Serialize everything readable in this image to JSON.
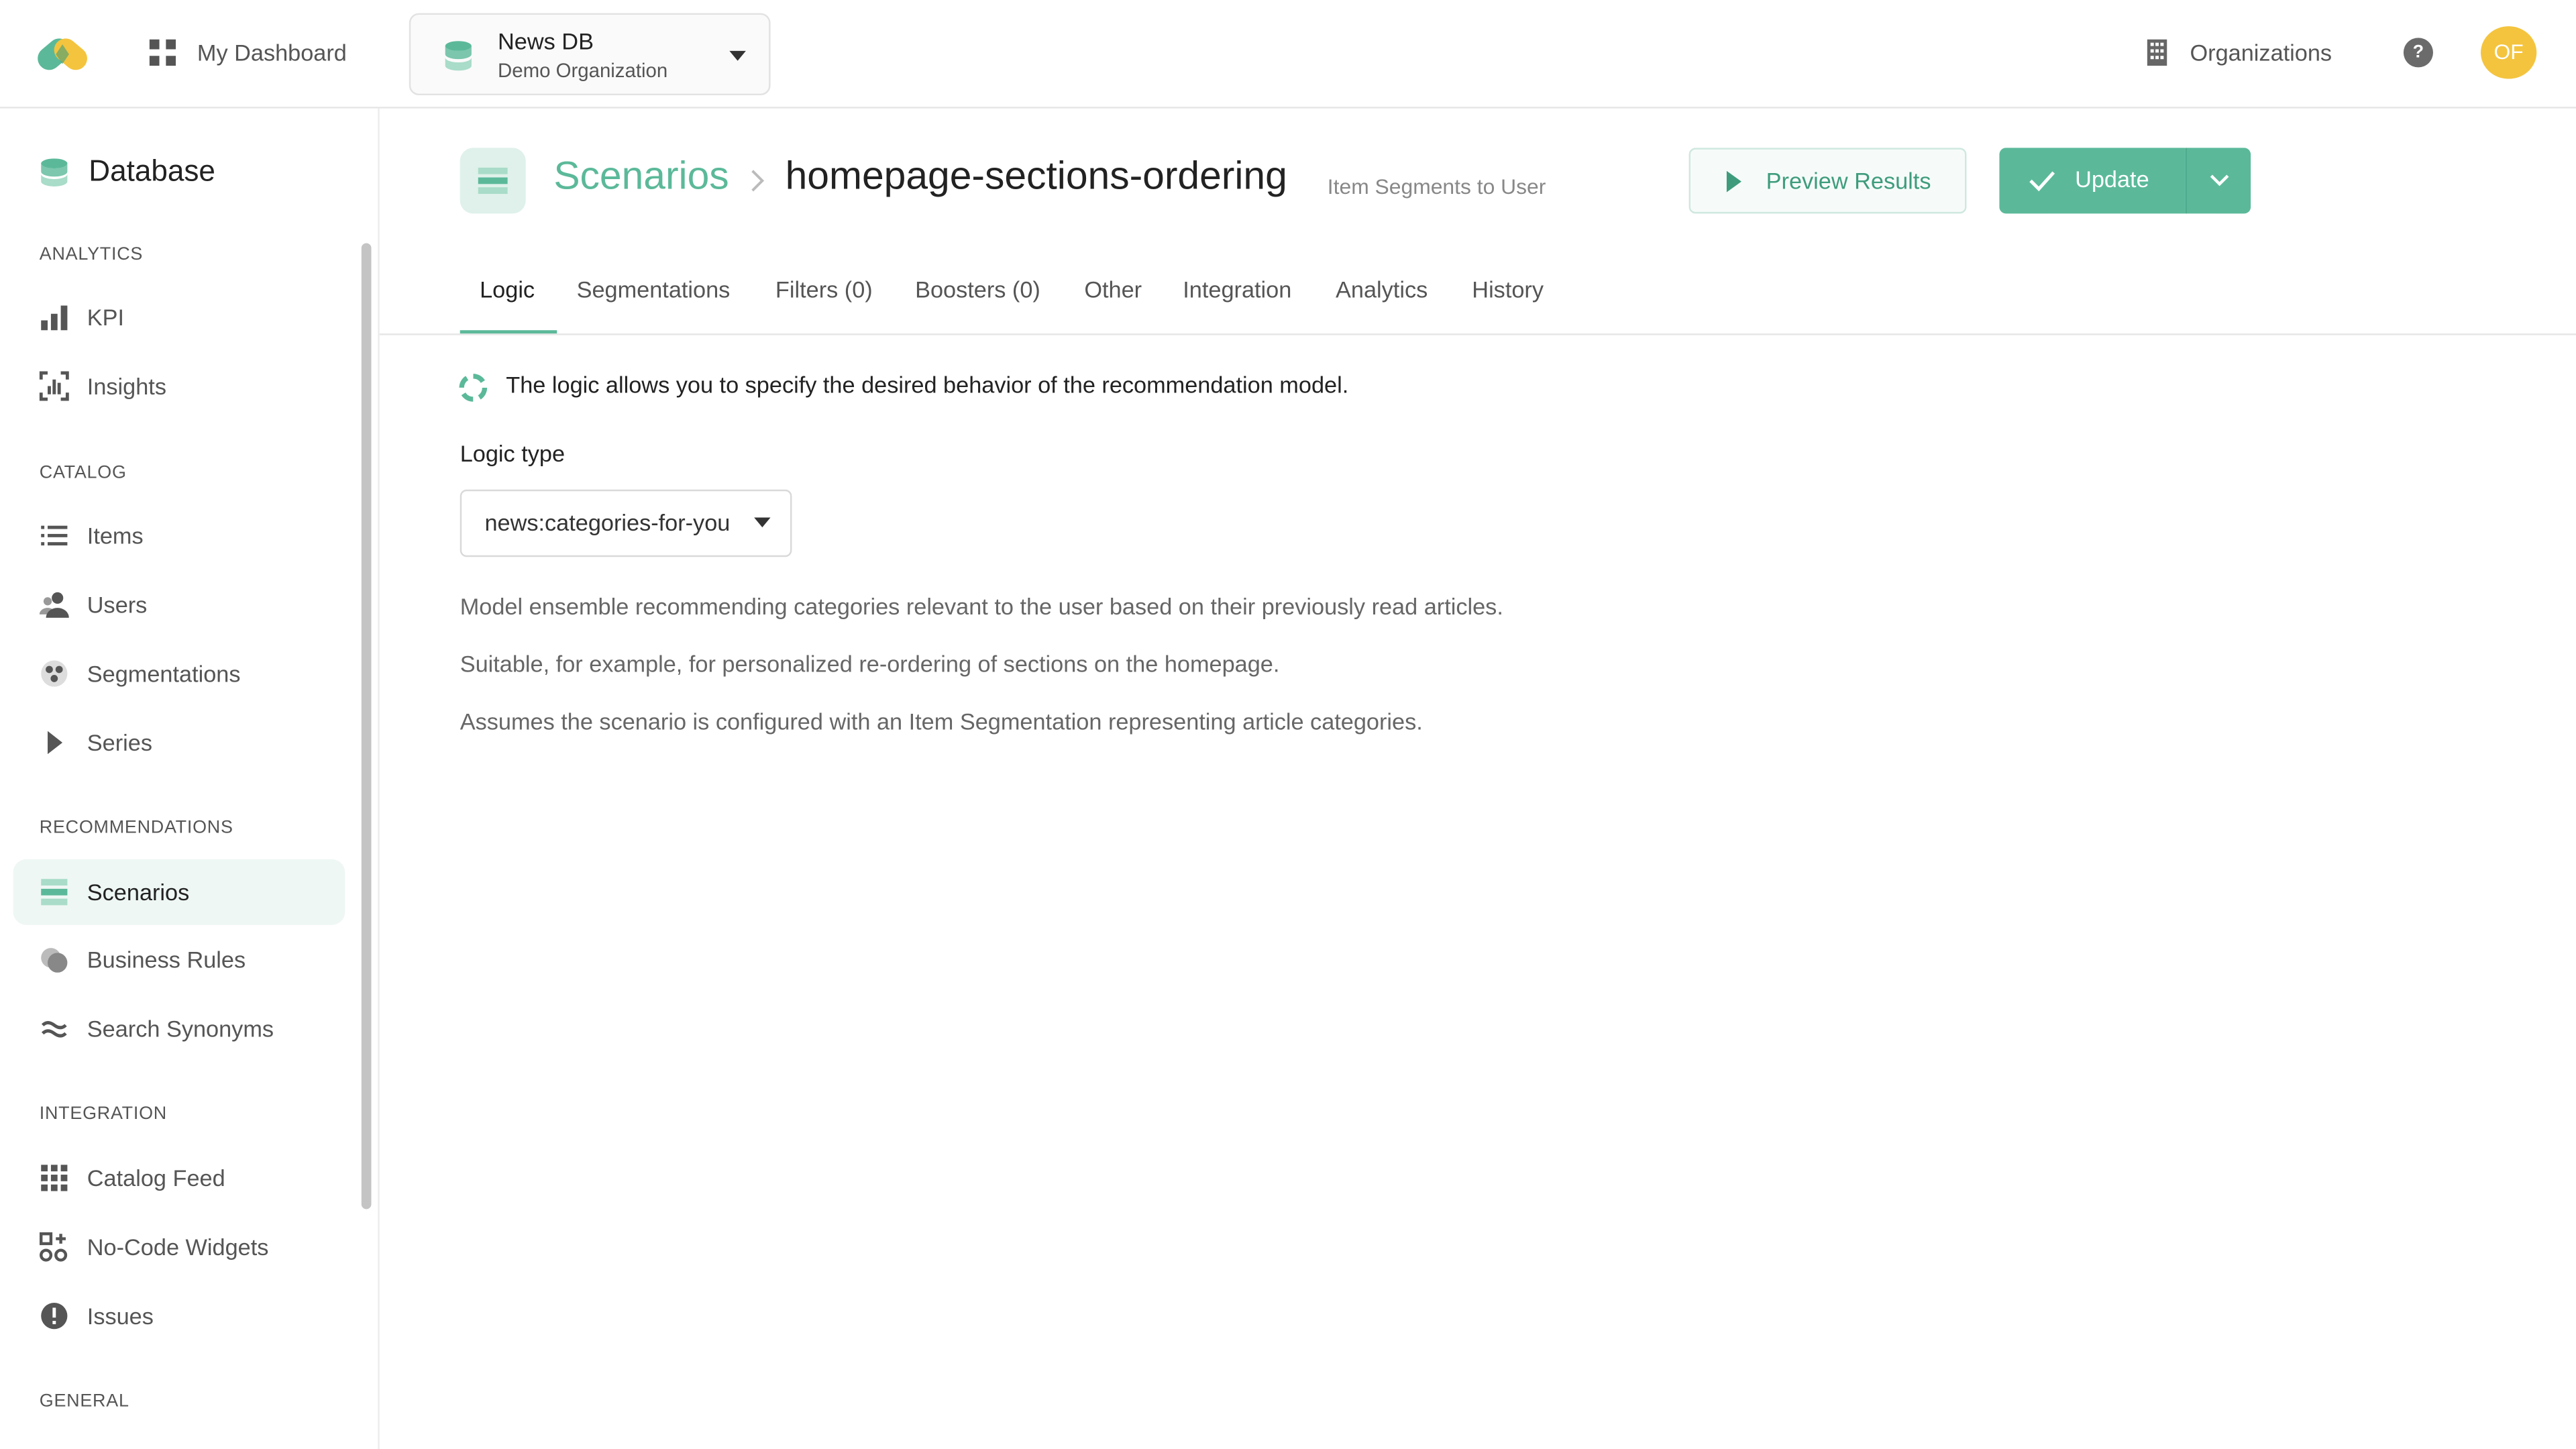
{
  "topbar": {
    "dashboard_label": "My Dashboard",
    "database_name": "News DB",
    "organization_name": "Demo Organization",
    "organizations_label": "Organizations",
    "help_label": "?",
    "avatar_initials": "OF"
  },
  "sidebar": {
    "title": "Database",
    "sections": {
      "analytics": "ANALYTICS",
      "catalog": "CATALOG",
      "recommendations": "RECOMMENDATIONS",
      "integration": "INTEGRATION",
      "general": "GENERAL"
    },
    "items": {
      "kpi": "KPI",
      "insights": "Insights",
      "items": "Items",
      "users": "Users",
      "segmentations": "Segmentations",
      "series": "Series",
      "scenarios": "Scenarios",
      "business_rules": "Business Rules",
      "search_synonyms": "Search Synonyms",
      "catalog_feed": "Catalog Feed",
      "no_code_widgets": "No-Code Widgets",
      "issues": "Issues"
    },
    "active_item": "Scenarios"
  },
  "header": {
    "breadcrumb_root": "Scenarios",
    "title": "homepage-sections-ordering",
    "subtitle": "Item Segments to User",
    "preview_label": "Preview Results",
    "update_label": "Update"
  },
  "tabs": {
    "logic": "Logic",
    "segmentations": "Segmentations",
    "filters": "Filters (0)",
    "boosters": "Boosters (0)",
    "other": "Other",
    "integration": "Integration",
    "analytics": "Analytics",
    "history": "History",
    "active": "Logic"
  },
  "content": {
    "info_text": "The logic allows you to specify the desired behavior of the recommendation model.",
    "logic_type_label": "Logic type",
    "logic_type_value": "news:categories-for-you",
    "description_1": "Model ensemble recommending categories relevant to the user based on their previously read articles.",
    "description_2": "Suitable, for example, for personalized re-ordering of sections on the homepage.",
    "description_3": "Assumes the scenario is configured with an Item Segmentation representing article categories."
  },
  "colors": {
    "accent": "#5bb99a",
    "accent_light": "#eef7f4",
    "avatar": "#f4c43e",
    "text_primary": "#222222",
    "text_secondary": "#555555"
  }
}
